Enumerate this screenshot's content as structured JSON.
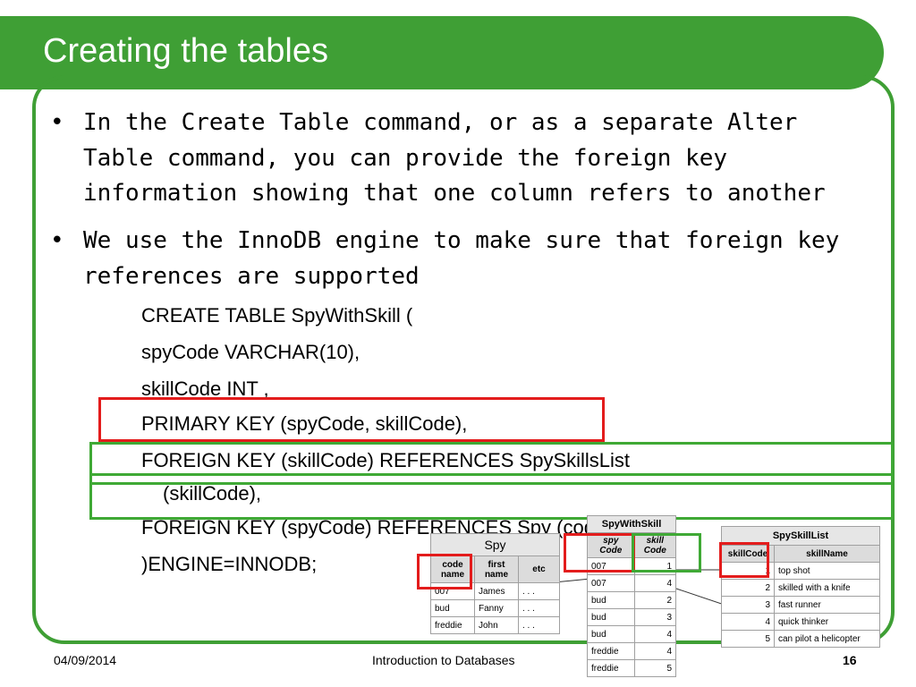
{
  "slide": {
    "title": "Creating the tables",
    "bullets": [
      {
        "symbol": "•",
        "lines": [
          "In the Create Table command, or as a separate Alter",
          "Table command, you can provide the foreign key",
          "information showing that one column refers to another"
        ]
      },
      {
        "symbol": "•",
        "lines": [
          "We use the InnoDB engine to make sure that foreign key",
          "references are supported"
        ]
      }
    ],
    "code": [
      "CREATE TABLE SpyWithSkill (",
      "spyCode VARCHAR(10),",
      "skillCode INT ,",
      "PRIMARY KEY (spyCode, skillCode),",
      "FOREIGN KEY (skillCode) REFERENCES SpySkillsList",
      "(skillCode),",
      "FOREIGN KEY (spyCode) REFERENCES Spy (codeName)",
      ")ENGINE=INNODB;"
    ]
  },
  "spy_table": {
    "caption": "Spy",
    "headers": [
      "code name",
      "first name",
      "etc"
    ],
    "rows": [
      [
        "007",
        "James",
        ". . ."
      ],
      [
        "bud",
        "Fanny",
        ". . ."
      ],
      [
        "freddie",
        "John",
        ". . ."
      ]
    ]
  },
  "spywithskill_table": {
    "caption": "SpyWithSkill",
    "headers": [
      "spy Code",
      "skill Code"
    ],
    "rows": [
      [
        "007",
        "1"
      ],
      [
        "007",
        "4"
      ],
      [
        "bud",
        "2"
      ],
      [
        "bud",
        "3"
      ],
      [
        "bud",
        "4"
      ],
      [
        "freddie",
        "4"
      ],
      [
        "freddie",
        "5"
      ]
    ]
  },
  "spyskilllist_table": {
    "caption": "SpySkillList",
    "headers": [
      "skillCode",
      "skillName"
    ],
    "rows": [
      [
        "1",
        "top shot"
      ],
      [
        "2",
        "skilled with a knife"
      ],
      [
        "3",
        "fast runner"
      ],
      [
        "4",
        "quick thinker"
      ],
      [
        "5",
        "can pilot a helicopter"
      ]
    ]
  },
  "footer": {
    "date": "04/09/2014",
    "center": "Introduction to Databases",
    "page": "16"
  },
  "colors": {
    "theme_green": "#3f9f35",
    "highlight_red": "#e31c1c",
    "highlight_green": "#3fa935"
  }
}
